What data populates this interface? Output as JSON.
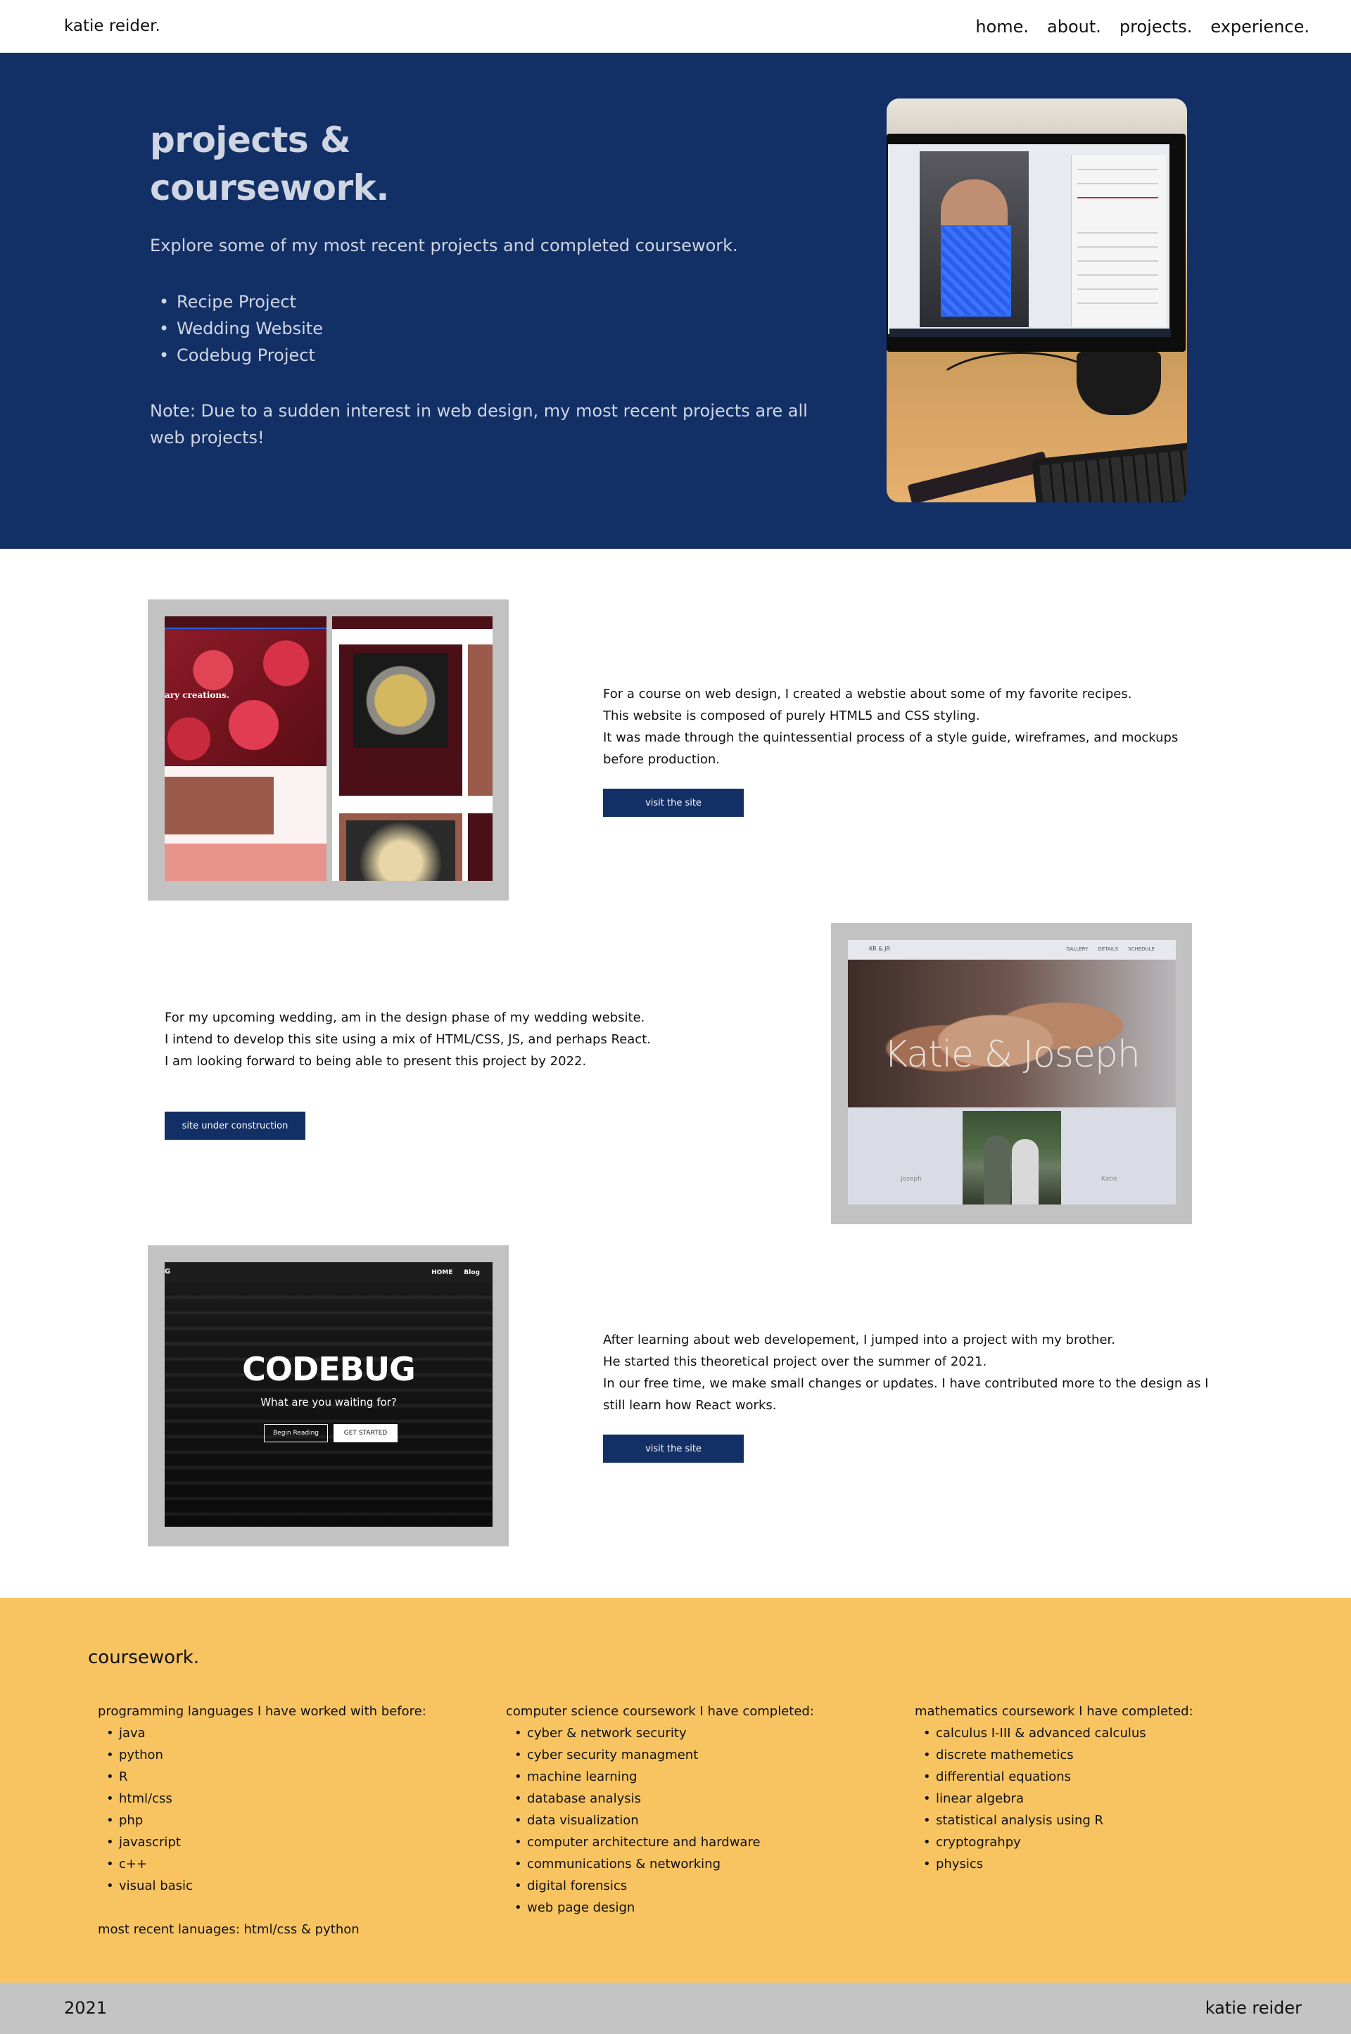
{
  "nav": {
    "brand": "katie reider.",
    "links": [
      "home.",
      "about.",
      "projects.",
      "experience."
    ]
  },
  "hero": {
    "title_line1": "projects &",
    "title_line2": "coursework.",
    "intro": "Explore some of my most recent projects and completed coursework.",
    "list": [
      "Recipe Project",
      "Wedding Website",
      "Codebug Project"
    ],
    "note": "Note: Due to a sudden interest in web design, my most recent projects are all web projects!"
  },
  "projects": [
    {
      "lines": [
        "For a course on web design, I created a webstie about some of my favorite recipes.",
        "This website is composed of purely HTML5 and CSS styling.",
        "It was made through the quintessential process of a style guide, wireframes, and mockups before production."
      ],
      "button": "visit the site",
      "mock": {
        "tagline": "ary creations."
      }
    },
    {
      "lines": [
        "For my upcoming wedding, am in the design phase of my wedding website.",
        "I intend to develop this site using a mix of HTML/CSS, JS, and perhaps React.",
        "I am looking forward to being able to present this project by 2022."
      ],
      "button": "site under construction",
      "mock": {
        "logo": "KR & JR",
        "menu": [
          "GALLERY",
          "DETAILS",
          "SCHEDULE"
        ],
        "names": "Katie & Joseph",
        "left_label": "Joseph",
        "right_label": "Katie"
      }
    },
    {
      "lines": [
        "After learning about web developement, I jumped into a project with my brother.",
        "He started this theoretical project over the summer of 2021.",
        "In our free time, we make small changes or updates. I have contributed more to the design as I still learn how React works."
      ],
      "button": "visit the site",
      "mock": {
        "logo": "G",
        "menu": [
          "HOME",
          "Blog"
        ],
        "title": "CODEBUG",
        "subtitle": "What are you waiting for?",
        "btn1": "Begin Reading",
        "btn2": "GET STARTED"
      }
    }
  ],
  "coursework": {
    "heading": "coursework.",
    "columns": [
      {
        "title": "programming languages I have worked with before:",
        "items": [
          "java",
          "python",
          "R",
          "html/css",
          "php",
          "javascript",
          "c++",
          "visual basic"
        ],
        "footer": "most recent lanuages: html/css & python"
      },
      {
        "title": "computer science coursework I have completed:",
        "items": [
          "cyber & network security",
          "cyber security managment",
          "machine learning",
          "database analysis",
          "data visualization",
          "computer architecture and hardware",
          "communications & networking",
          "digital forensics",
          "web page design"
        ]
      },
      {
        "title": "mathematics coursework I have completed:",
        "items": [
          "calculus I-III & advanced calculus",
          "discrete mathemetics",
          "differential equations",
          "linear algebra",
          "statistical analysis using R",
          "cryptograhpy",
          "physics"
        ]
      }
    ]
  },
  "footer": {
    "year": "2021",
    "name": "katie reider"
  },
  "colors": {
    "navy": "#123066",
    "gold": "#f8c462",
    "gray": "#c4c4c4"
  }
}
